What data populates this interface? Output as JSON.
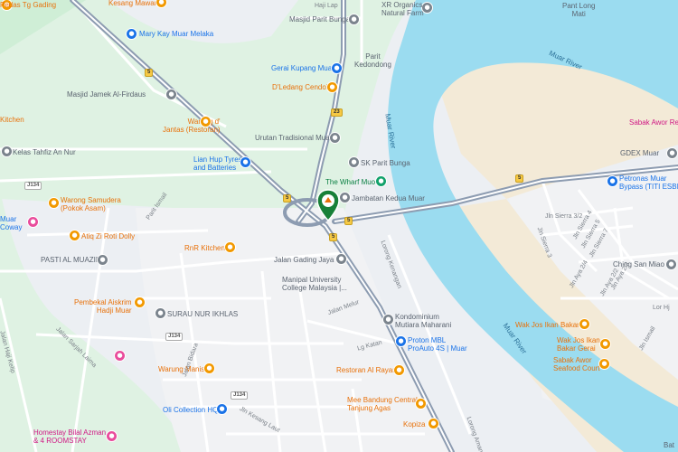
{
  "map": {
    "water": {
      "river_name": "Muar River"
    },
    "route_shields": {
      "r5a": "5",
      "r5b": "5",
      "r5c": "5",
      "r5d": "5",
      "r5e": "5",
      "r23": "23",
      "j134a": "J134",
      "j134b": "J134",
      "j134c": "J134"
    },
    "labels": {
      "pedas": "Pedas Tg Gading",
      "kesang": "Kesang Mawar",
      "marykay": "Mary Kay Muar Melaka",
      "masjid_parit": "Masjid Parit Bunga",
      "xr": "XR Organics\nNatural Farm",
      "pantlong": "Pant Long\nMati",
      "gerai": "Gerai Kupang Muar",
      "paritkedondong": "Parit\nKedondong",
      "dledang": "D'Ledang Cendol",
      "masjid_firdaus": "Masjid Jamek Al-Firdaus",
      "kitchen": "Kitchen",
      "warung_d": "Warung d'\nJantas (Restoran)",
      "urutan": "Urutan Tradisional Muar",
      "kelas": "Kelas Tahfiz An Nur",
      "lianhup": "Lian Hup Tyres\nand Batteries",
      "skparit": "SK Parit Bunga",
      "wharf": "The Wharf Muo",
      "jambatan": "Jambatan Kedua Muar",
      "muarriver_vert": "Muar River",
      "muarriver_top": "Muar River",
      "muarriver_bottom": "Muar River",
      "sabak": "Sabak Awor Res",
      "gdex": "GDEX Muar",
      "petronas": "Petronas Muar\nBypass (TITI ESBI...",
      "waroeng": "Warong Samudera\n(Pokok Asam)",
      "muar_coway": "Muar\nCoway",
      "atiq": "Atiq Zi Roti Dolly",
      "rnr": "RnR Kitchen",
      "parit_ismail": "Parit Ismail",
      "pasti": "PASTI AL MUAZIM",
      "jgj": "Jalan Gading Jaya 1",
      "manipal": "Manipal University\nCollege Malaysia |...",
      "loringkenanga": "Lorong Kenangan",
      "jlnsierra32": "Jln Sierra 3/2",
      "jlnsierra4": "Jln Sierra 4",
      "jlnsierra5": "Jln Sierra 5",
      "jlnsierra7": "Jln Sierra 7",
      "jlnsierra3": "Jln Sierra 3",
      "chingsan": "Ching San Miao",
      "pembekal": "Pembekal Aiskrim\nHadji Muar",
      "surau": "SURAU NUR IKHLAS",
      "jalanmelur": "Jalan Melur",
      "kondo": "Kondominium\nMutiara Maharani",
      "wakjos1": "Wak Jos Ikan Bakar",
      "wakjos2": "Wak Jos Ikan\nBakar Gerai",
      "sabakseafood": "Sabak Awor\nSeafood Court",
      "jlnsarjah": "Jalan Sarjah Laima",
      "lgkatan": "Lg Katan",
      "proton": "Proton MBL\nProAuto 4S | Muar",
      "warungmanis": "Warung Manis",
      "restoran_alrayan": "Restoran Al Rayan",
      "jalanbidara": "Jalan Bidara",
      "olicollection": "Oli Collection HQ",
      "meebandung": "Mee Bandung Central\nTanjung Agas",
      "homestay": "Homestay Bilal Azman\n& 4 ROOMSTAY",
      "jlnkesang": "Jln Kesang Laut",
      "kopiza": "Kopiza",
      "lorongaman": "Lorong Aman",
      "jlnismail": "Jln Ismail",
      "jlnhajikelip": "Jalan Haji Kelip",
      "jlnaya": "Jln Aya 2/4",
      "jlnaya22": "Jln Aya 2/2",
      "jlnaya23": "Jln Aya 2/3",
      "jlnsirfa4": "Jln Sirfa 4",
      "loring": "Lor Hj",
      "hajilap": "Haji Lap",
      "bat": "Bat"
    },
    "icons": {
      "restaurant": "restaurant-icon",
      "shopping": "shopping-icon",
      "worship": "mosque-icon",
      "school": "school-icon",
      "store": "store-icon",
      "pin": "location-pin-icon"
    }
  }
}
